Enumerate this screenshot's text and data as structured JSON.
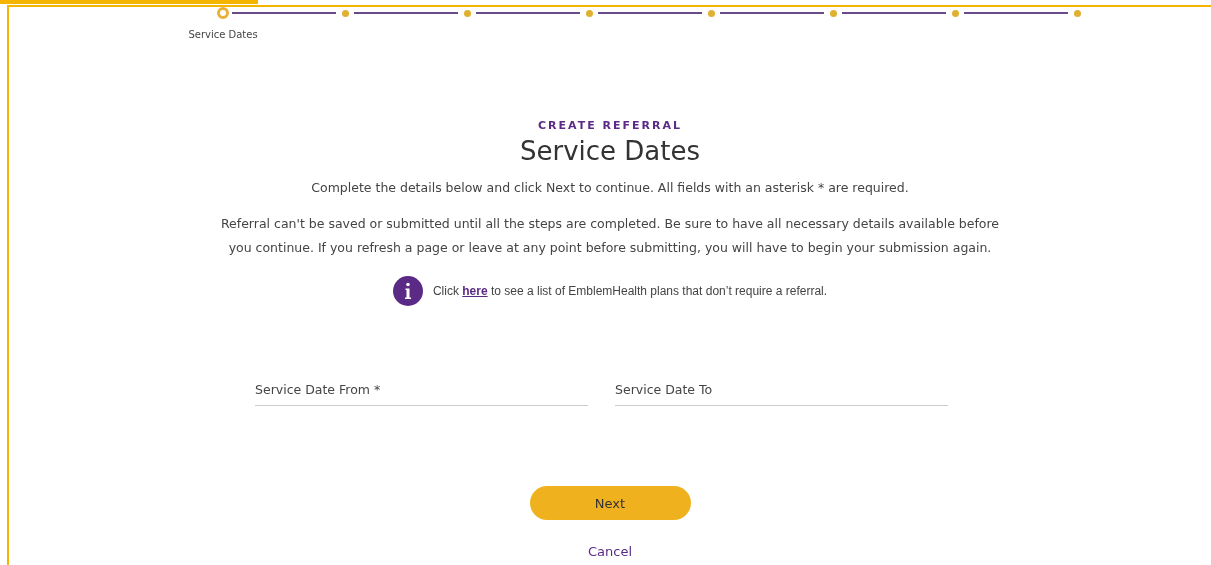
{
  "stepper": {
    "steps": [
      {
        "label": "Service Dates",
        "current": true
      },
      {
        "current": false
      },
      {
        "current": false
      },
      {
        "current": false
      },
      {
        "current": false
      },
      {
        "current": false
      },
      {
        "current": false
      },
      {
        "current": false
      }
    ]
  },
  "header": {
    "eyebrow": "CREATE REFERRAL",
    "title": "Service Dates"
  },
  "instructions": [
    "Complete the details below and click Next to continue. All fields with an asterisk * are required.",
    "Referral can't be saved or submitted until all the steps are completed. Be sure to have all necessary details available before you continue. If you refresh a page or leave at any point before submitting, you will have to begin your submission again."
  ],
  "info": {
    "before": "Click",
    "link": "here",
    "after": "to see a list of EmblemHealth plans that don’t require a referral."
  },
  "fields": [
    {
      "placeholder": "Service Date From *"
    },
    {
      "placeholder": "Service Date To"
    }
  ],
  "buttons": {
    "next": "Next",
    "cancel": "Cancel"
  }
}
